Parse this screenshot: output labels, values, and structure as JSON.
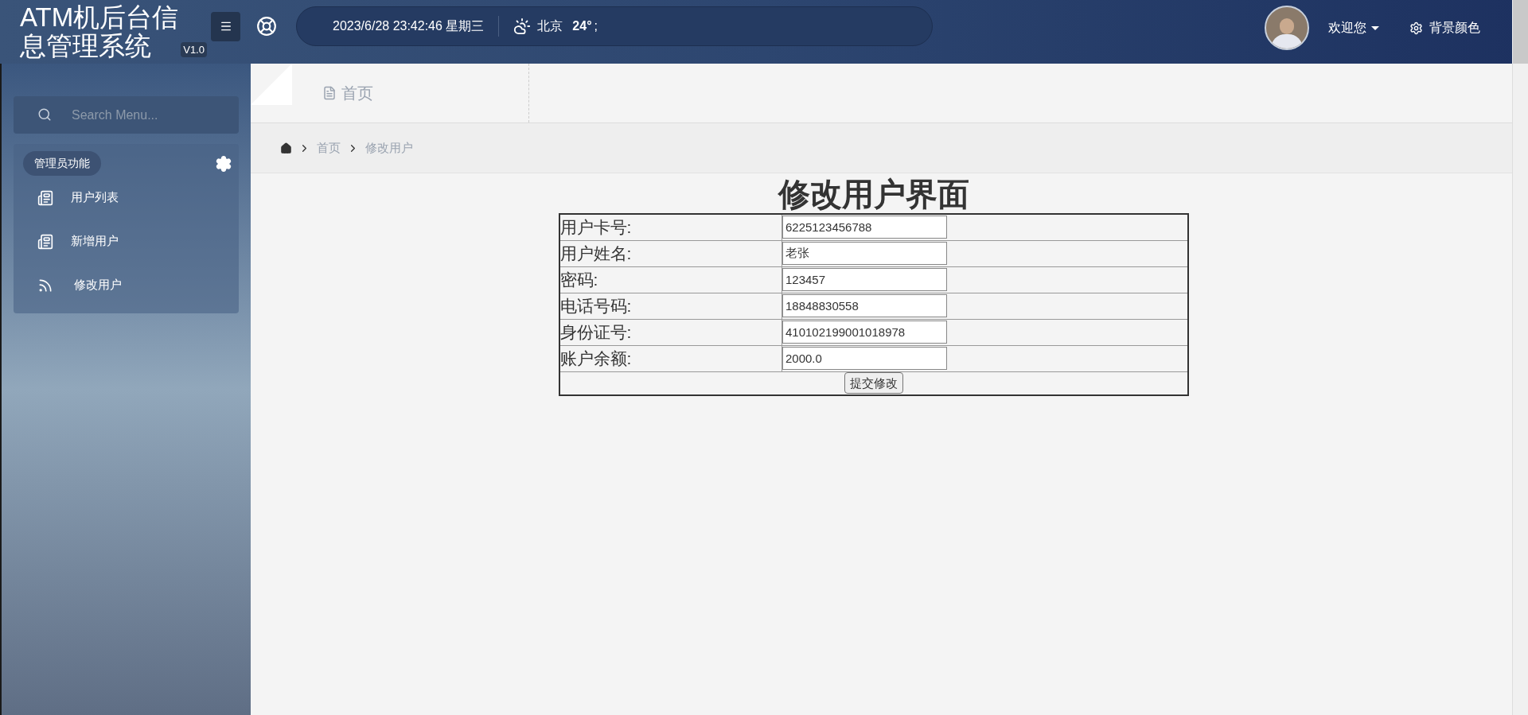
{
  "app": {
    "title": "ATM机后台信息管理系统",
    "version": "V1.0"
  },
  "header": {
    "datetime": "2023/6/28 23:42:46 星期三",
    "city": "北京",
    "temperature": "24°",
    "weather_suffix": ";",
    "welcome": "欢迎您",
    "theme_button": "背景颜色"
  },
  "sidebar": {
    "search": {
      "placeholder": "Search Menu..."
    },
    "section": "管理员功能",
    "items": [
      {
        "label": "用户列表",
        "kind": "document"
      },
      {
        "label": "新增用户",
        "kind": "document"
      },
      {
        "label": "修改用户",
        "kind": "feed"
      }
    ]
  },
  "tabs": [
    {
      "label": "首页",
      "selected": false
    }
  ],
  "breadcrumb": [
    "首页",
    "修改用户"
  ],
  "form": {
    "title": "修改用户界面",
    "fields": [
      {
        "label": "用户卡号:",
        "value": "6225123456788"
      },
      {
        "label": "用户姓名:",
        "value": "老张"
      },
      {
        "label": "密码:",
        "value": "123457"
      },
      {
        "label": "电话号码:",
        "value": "18848830558"
      },
      {
        "label": "身份证号:",
        "value": "410102199001018978"
      },
      {
        "label": "账户余额:",
        "value": "2000.0"
      }
    ],
    "submit": "提交修改"
  }
}
